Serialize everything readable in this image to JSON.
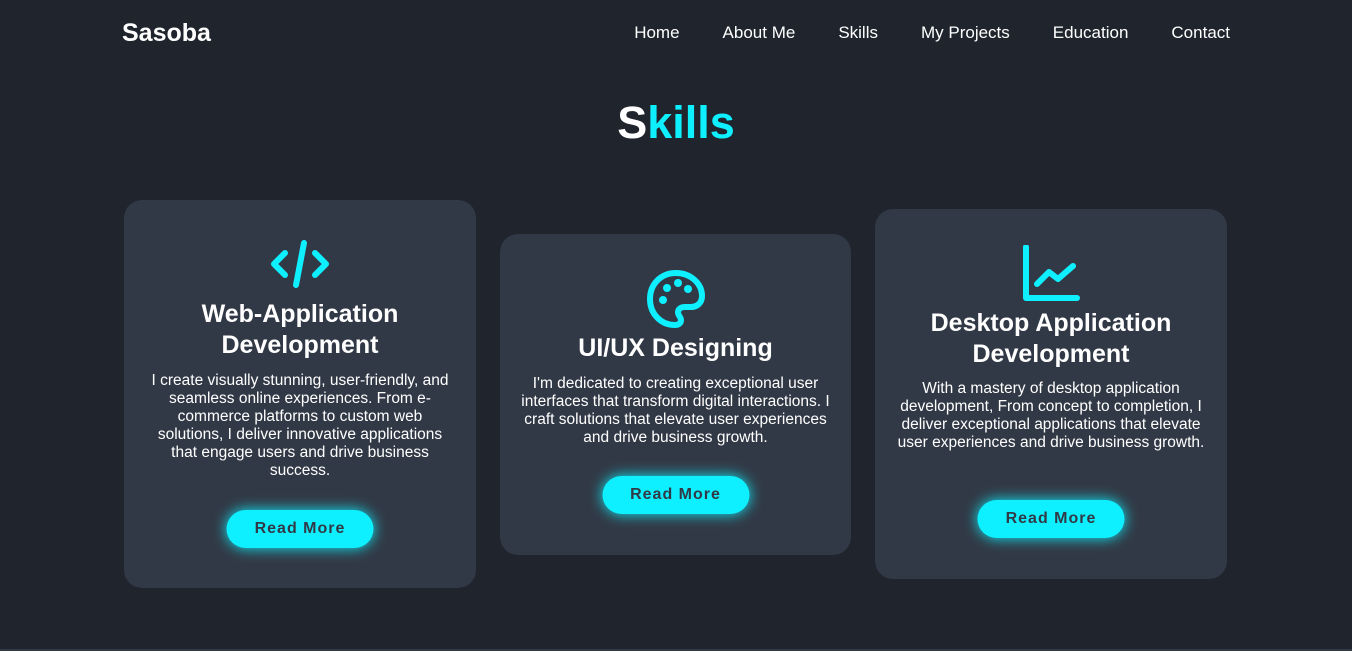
{
  "header": {
    "logo": "Sasoba",
    "nav": [
      "Home",
      "About Me",
      "Skills",
      "My Projects",
      "Education",
      "Contact"
    ]
  },
  "section": {
    "heading_first": "S",
    "heading_rest": "kills"
  },
  "cards": [
    {
      "icon": "code-icon",
      "title": "Web-Application Development",
      "text": "I create visually stunning, user-friendly, and seamless online experiences. From e-commerce platforms to custom web solutions, I deliver innovative applications that engage users and drive business success.",
      "button": "Read More"
    },
    {
      "icon": "palette-icon",
      "title": "UI/UX Designing",
      "text": "I'm dedicated to creating exceptional user interfaces that transform digital interactions. I craft solutions that elevate user experiences and drive business growth.",
      "button": "Read More"
    },
    {
      "icon": "line-chart-icon",
      "title": "Desktop Application Development",
      "text": "With a mastery of desktop application development, From concept to completion, I deliver exceptional applications that elevate user experiences and drive business growth.",
      "button": "Read More"
    }
  ],
  "colors": {
    "background": "#1f242d",
    "card": "#323946",
    "accent": "#0ef0ff",
    "text": "#ffffff"
  }
}
